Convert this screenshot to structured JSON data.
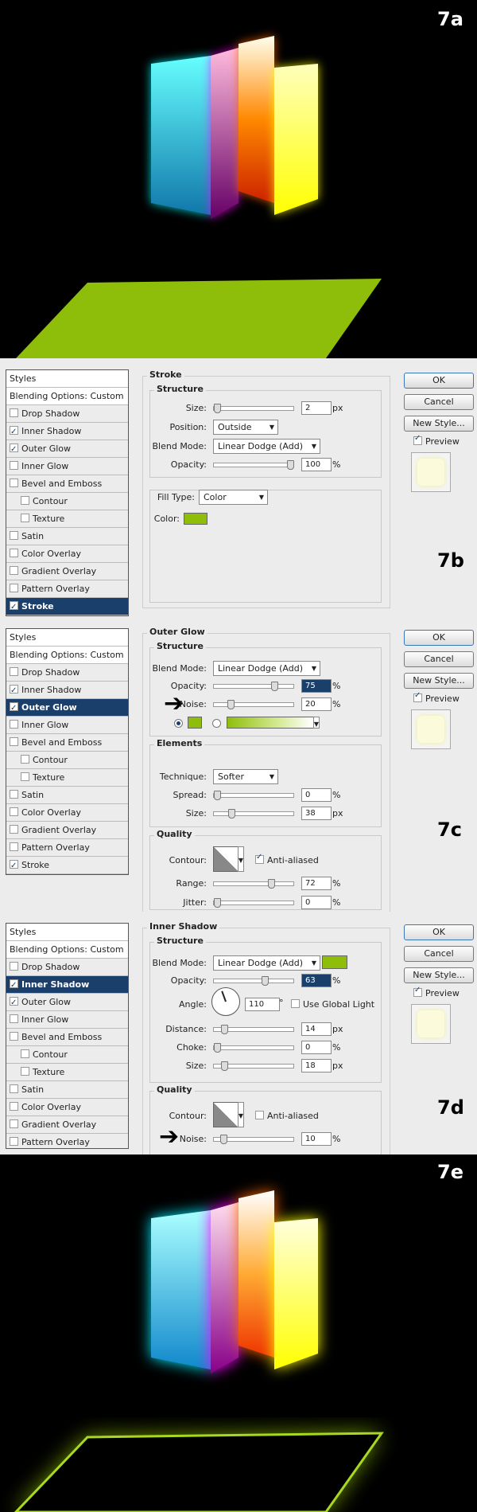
{
  "steps": {
    "a": "7a",
    "b": "7b",
    "c": "7c",
    "d": "7d",
    "e": "7e"
  },
  "colors": {
    "green": "#8fbe0a",
    "selection": "#1b3f6b",
    "dialog_bg": "#ececec"
  },
  "buttons": {
    "ok": "OK",
    "cancel": "Cancel",
    "new_style": "New Style...",
    "preview": "Preview"
  },
  "styles_list": {
    "header": "Styles",
    "blending": "Blending Options: Custom",
    "drop_shadow": "Drop Shadow",
    "inner_shadow": "Inner Shadow",
    "outer_glow": "Outer Glow",
    "inner_glow": "Inner Glow",
    "bevel": "Bevel and Emboss",
    "contour": "Contour",
    "texture": "Texture",
    "satin": "Satin",
    "color_overlay": "Color Overlay",
    "gradient_overlay": "Gradient Overlay",
    "pattern_overlay": "Pattern Overlay",
    "stroke": "Stroke"
  },
  "stroke": {
    "title": "Stroke",
    "structure": "Structure",
    "size_label": "Size:",
    "size_value": "2",
    "size_unit": "px",
    "position_label": "Position:",
    "position_value": "Outside",
    "blend_label": "Blend Mode:",
    "blend_value": "Linear Dodge (Add)",
    "opacity_label": "Opacity:",
    "opacity_value": "100",
    "percent": "%",
    "fill_type_label": "Fill Type:",
    "fill_type_value": "Color",
    "color_label": "Color:"
  },
  "outer_glow": {
    "title": "Outer Glow",
    "structure": "Structure",
    "blend_label": "Blend Mode:",
    "blend_value": "Linear Dodge (Add)",
    "opacity_label": "Opacity:",
    "opacity_value": "75",
    "noise_label": "Noise:",
    "noise_value": "20",
    "percent": "%",
    "elements": "Elements",
    "technique_label": "Technique:",
    "technique_value": "Softer",
    "spread_label": "Spread:",
    "spread_value": "0",
    "size_label": "Size:",
    "size_value": "38",
    "px": "px",
    "quality": "Quality",
    "contour_label": "Contour:",
    "anti_aliased": "Anti-aliased",
    "range_label": "Range:",
    "range_value": "72",
    "jitter_label": "Jitter:",
    "jitter_value": "0"
  },
  "inner_shadow": {
    "title": "Inner Shadow",
    "structure": "Structure",
    "blend_label": "Blend Mode:",
    "blend_value": "Linear Dodge (Add)",
    "opacity_label": "Opacity:",
    "opacity_value": "63",
    "percent": "%",
    "angle_label": "Angle:",
    "angle_value": "110",
    "degree": "°",
    "global_light": "Use Global Light",
    "distance_label": "Distance:",
    "distance_value": "14",
    "choke_label": "Choke:",
    "choke_value": "0",
    "size_label": "Size:",
    "size_value": "18",
    "px": "px",
    "quality": "Quality",
    "contour_label": "Contour:",
    "anti_aliased": "Anti-aliased",
    "noise_label": "Noise:",
    "noise_value": "10"
  }
}
